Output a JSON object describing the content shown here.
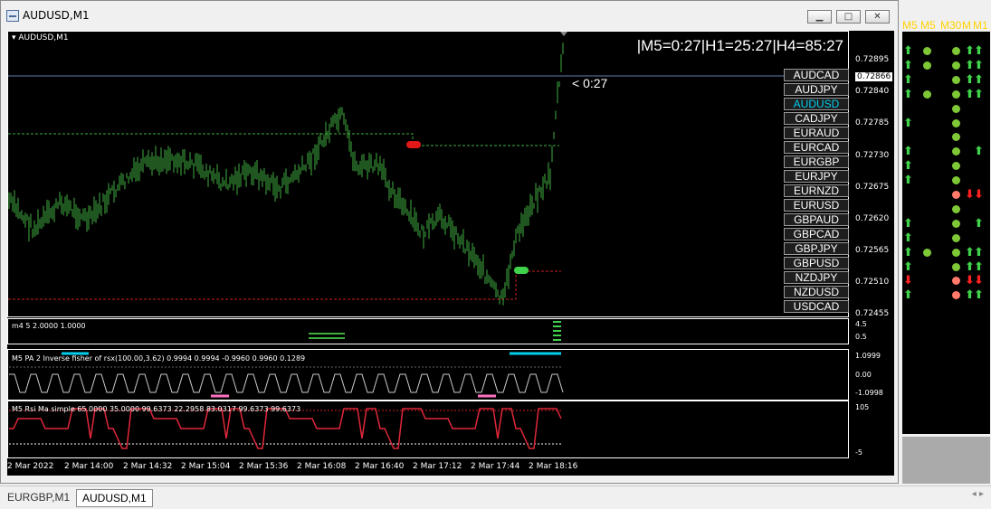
{
  "window": {
    "title": "AUDUSD,M1"
  },
  "chart": {
    "symbol_label": "AUDUSD,M1",
    "timeframe_timer": "|M5=0:27|H1=25:27|H4=85:27",
    "bar_timer": "< 0:27",
    "price_labels": [
      "0.72895",
      "0.72840",
      "0.72785",
      "0.72730",
      "0.72675",
      "0.72620",
      "0.72565",
      "0.72510",
      "0.72455"
    ],
    "current_price": "0.72866",
    "time_labels": [
      "2 Mar 2022",
      "2 Mar 14:00",
      "2 Mar 14:32",
      "2 Mar 15:04",
      "2 Mar 15:36",
      "2 Mar 16:08",
      "2 Mar 16:40",
      "2 Mar 17:12",
      "2 Mar 17:44",
      "2 Mar 18:16"
    ],
    "symbols": [
      "AUDCAD",
      "AUDJPY",
      "AUDUSD",
      "CADJPY",
      "EURAUD",
      "EURCAD",
      "EURGBP",
      "EURJPY",
      "EURNZD",
      "EURUSD",
      "GBPAUD",
      "GBPCAD",
      "GBPJPY",
      "GBPUSD",
      "NZDJPY",
      "NZDUSD",
      "USDCAD"
    ],
    "active_symbol": "AUDUSD",
    "colors": {
      "bars": "#3fae3f",
      "up_signal": "#3fd24a",
      "down_signal": "#ff2020",
      "accent": "#00d0f0"
    }
  },
  "indicators": {
    "ind1": {
      "label": "m4 5 2.0000 1.0000",
      "values": [
        "4.5",
        "0.5"
      ]
    },
    "ind2": {
      "label": "M5 PA 2 Inverse fisher of rsx(100.00,3.62) 0.9994 0.9994 -0.9960 0.9960 0.1289",
      "values": [
        "1.0999",
        "0.00",
        "-1.0998"
      ]
    },
    "ind3": {
      "label": "M5 Rsi Ma simple 65.0000 35.0000 99.6373 22.2958 83.0317 99.6373 99.6373",
      "values": [
        "105",
        "-5"
      ]
    }
  },
  "signal_panel": {
    "headers": [
      "M5",
      "M5",
      "M30",
      "M",
      "M1"
    ]
  },
  "tabs": [
    "EURGBP,M1",
    "AUDUSD,M1"
  ],
  "active_tab": "AUDUSD,M1"
}
